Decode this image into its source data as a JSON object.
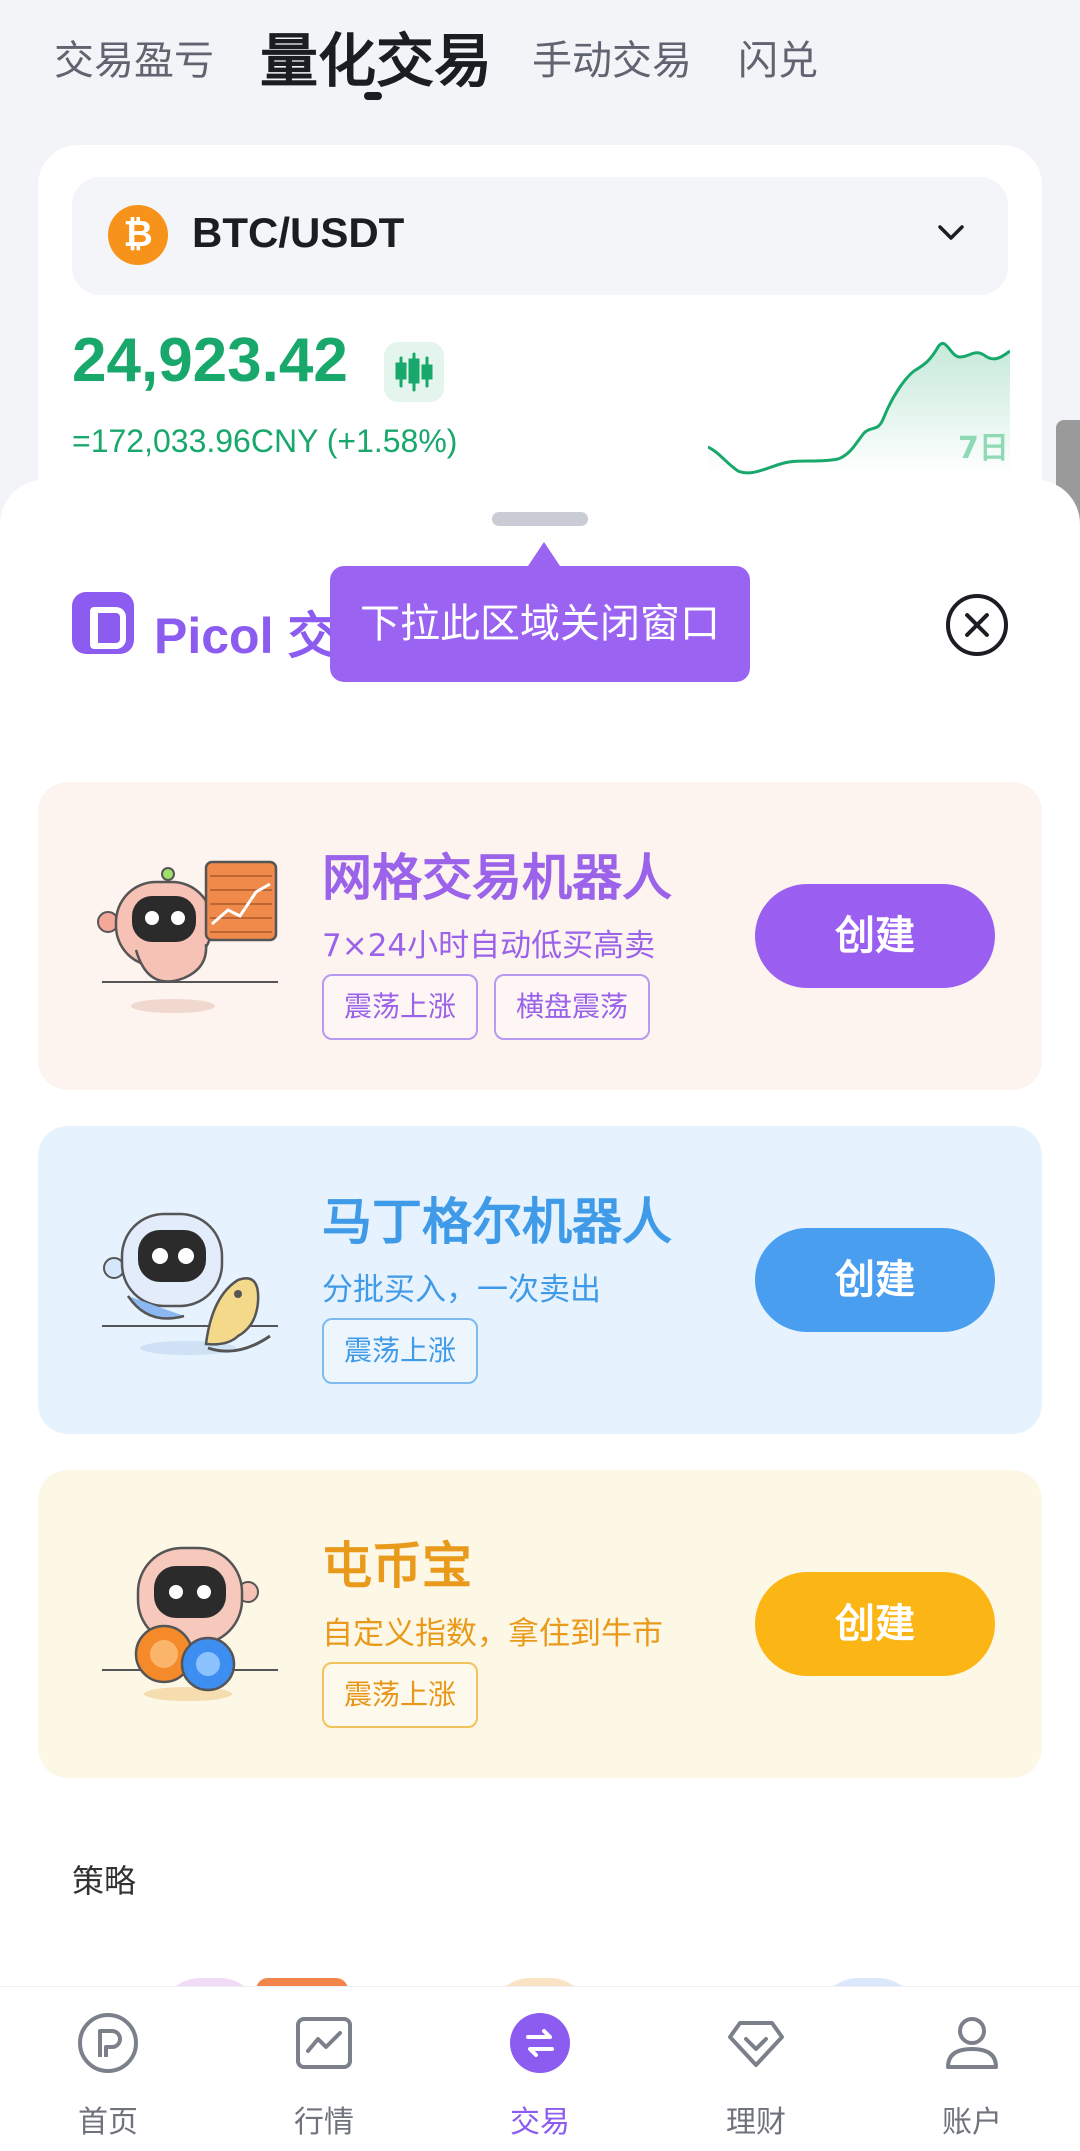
{
  "tabs": {
    "items": [
      {
        "label": "交易盈亏"
      },
      {
        "label": "量化交易"
      },
      {
        "label": "手动交易"
      },
      {
        "label": "闪兑"
      }
    ],
    "active": "量化交易"
  },
  "market": {
    "pair": "BTC/USDT",
    "coin_symbol": "₿",
    "price": "24,923.42",
    "fiat_line": "=172,033.96CNY (+1.58%)",
    "range_label": "7日",
    "up_color": "#18a86b"
  },
  "sheet": {
    "brand": "Picol 交",
    "tooltip": "下拉此区域关闭窗口"
  },
  "bots": [
    {
      "title": "网格交易机器人",
      "desc": "7×24小时自动低买高卖",
      "tags": [
        "震荡上涨",
        "横盘震荡"
      ],
      "button": "创建",
      "accent": "#9a5ff0"
    },
    {
      "title": "马丁格尔机器人",
      "desc": "分批买入，一次卖出",
      "tags": [
        "震荡上涨"
      ],
      "button": "创建",
      "accent": "#4a9ef0"
    },
    {
      "title": "屯币宝",
      "desc": "自定义指数，拿住到牛市",
      "tags": [
        "震荡上涨"
      ],
      "button": "创建",
      "accent": "#fbb515"
    }
  ],
  "strategy": {
    "heading": "策略"
  },
  "nav": {
    "items": [
      {
        "label": "首页",
        "icon": "home-icon"
      },
      {
        "label": "行情",
        "icon": "chart-icon"
      },
      {
        "label": "交易",
        "icon": "swap-icon"
      },
      {
        "label": "理财",
        "icon": "diamond-icon"
      },
      {
        "label": "账户",
        "icon": "user-icon"
      }
    ],
    "active": "交易",
    "accent": "#8c5bf0"
  }
}
